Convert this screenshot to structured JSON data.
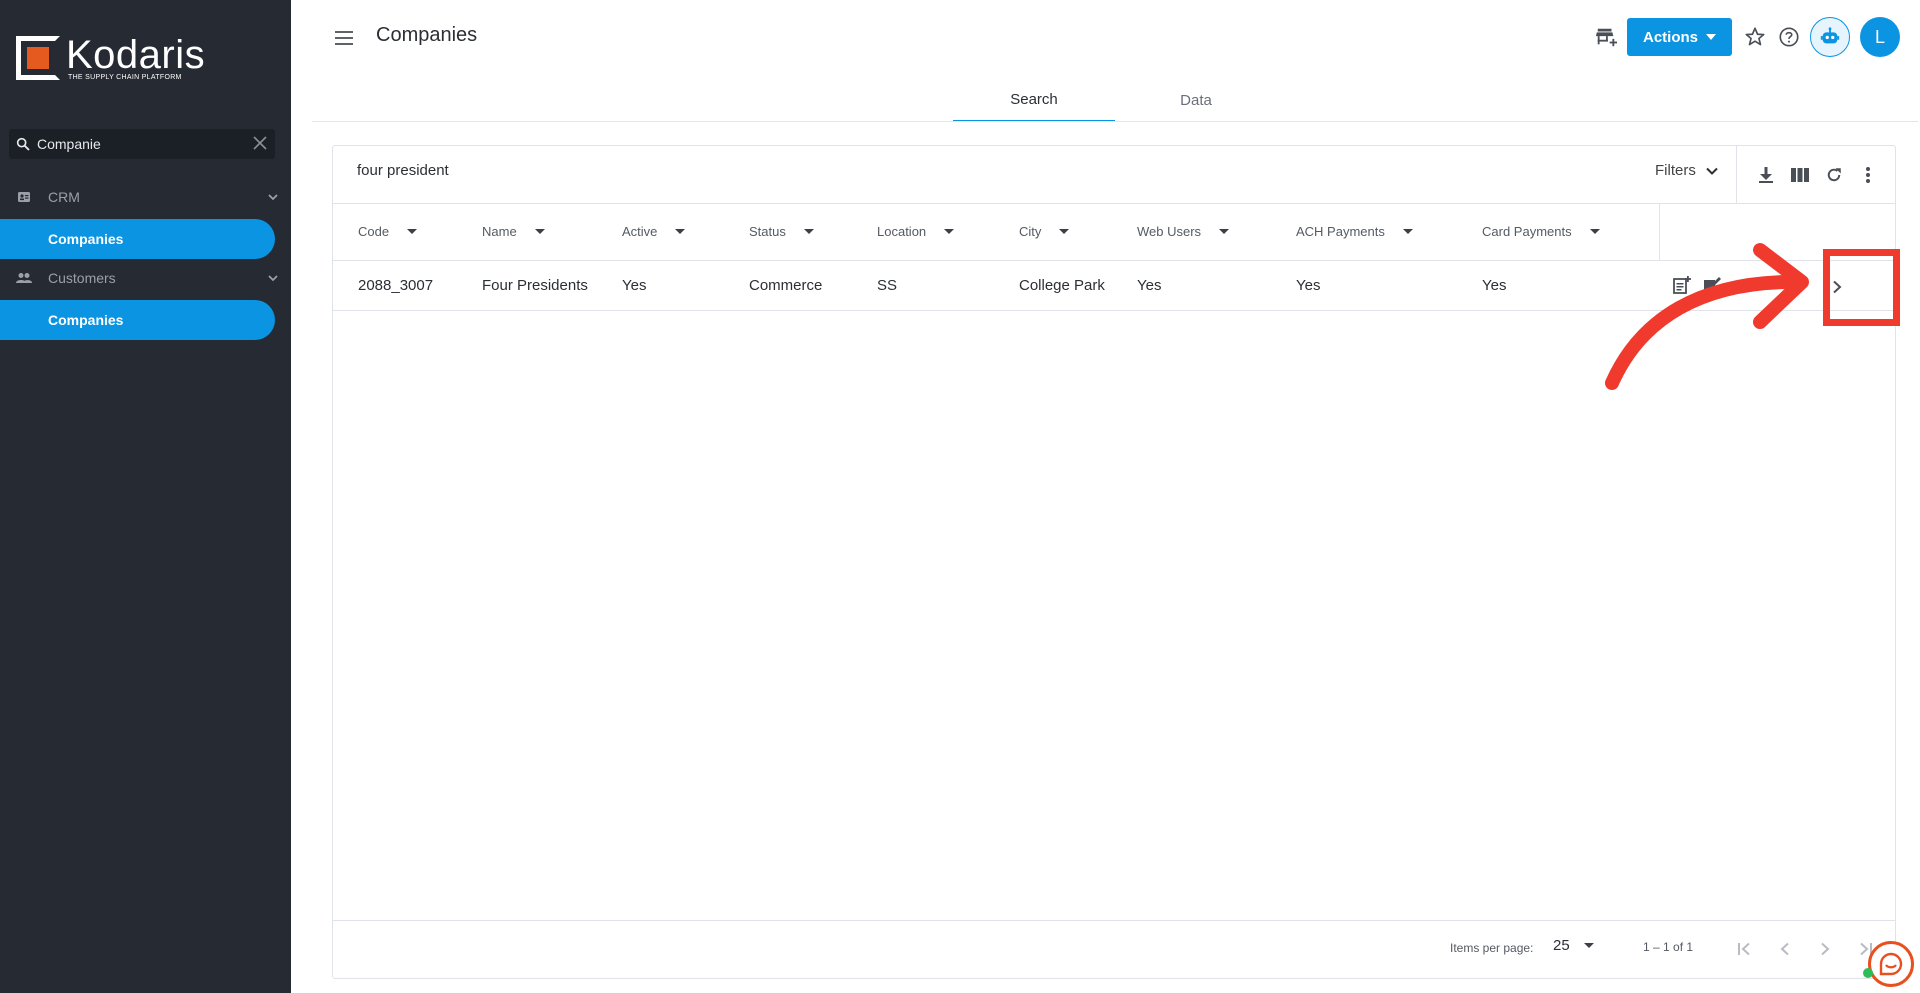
{
  "brand": {
    "name": "Kodaris",
    "tagline": "THE SUPPLY CHAIN PLATFORM"
  },
  "sidebar": {
    "search_value": "Companie",
    "groups": [
      {
        "label": "CRM",
        "icon": "contact-card-icon",
        "items": [
          {
            "label": "Companies",
            "active": true
          }
        ]
      },
      {
        "label": "Customers",
        "icon": "people-icon",
        "items": [
          {
            "label": "Companies",
            "active": true
          }
        ]
      }
    ]
  },
  "header": {
    "title": "Companies",
    "actions_label": "Actions",
    "avatar_initial": "L"
  },
  "tabs": [
    {
      "label": "Search",
      "active": true
    },
    {
      "label": "Data",
      "active": false
    }
  ],
  "toolbar": {
    "query": "four president",
    "filters_label": "Filters"
  },
  "table": {
    "columns": [
      "Code",
      "Name",
      "Active",
      "Status",
      "Location",
      "City",
      "Web Users",
      "ACH Payments",
      "Card Payments"
    ],
    "rows": [
      [
        "2088_3007",
        "Four Presidents",
        "Yes",
        "Commerce",
        "SS",
        "College Park",
        "Yes",
        "Yes",
        "Yes"
      ]
    ]
  },
  "footer": {
    "items_per_page_label": "Items per page:",
    "items_per_page": "25",
    "range": "1 – 1 of 1"
  },
  "colors": {
    "accent": "#0a94e2",
    "sidebar": "#252a33",
    "annotation": "#f03a2e",
    "brand_orange": "#e55a1f"
  }
}
